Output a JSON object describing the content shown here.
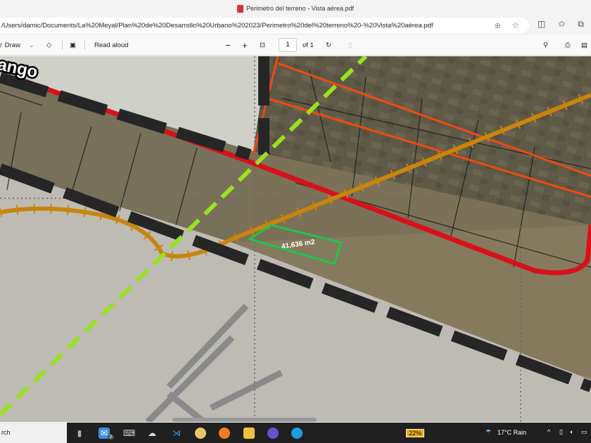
{
  "window": {
    "title": "Perimetro del terreno - Vista aérea.pdf"
  },
  "address_bar": {
    "url": "/Users/damic/Documents/La%20Meyal/Plan%20de%20Desarrollo%20Urbano%202023/Perimetro%20del%20terreno%20-%20Vista%20aérea.pdf"
  },
  "toolbar": {
    "draw_label": "Draw",
    "read_aloud_label": "Read aloud",
    "zoom_out": "−",
    "zoom_in": "+",
    "page_current": "1",
    "page_total": "of 1"
  },
  "map": {
    "place_label": "ango",
    "area_label": "41,636 m2"
  },
  "taskbar": {
    "search_label": "rch",
    "mail_badge": "2",
    "battery": "22%",
    "weather": "17°C  Rain"
  },
  "colors": {
    "road_red": "#d8111b",
    "rail_orange": "#c8850e",
    "highway_lime": "#9be01e",
    "parcel_green": "#1fc64a",
    "boundary_black": "#262626"
  }
}
